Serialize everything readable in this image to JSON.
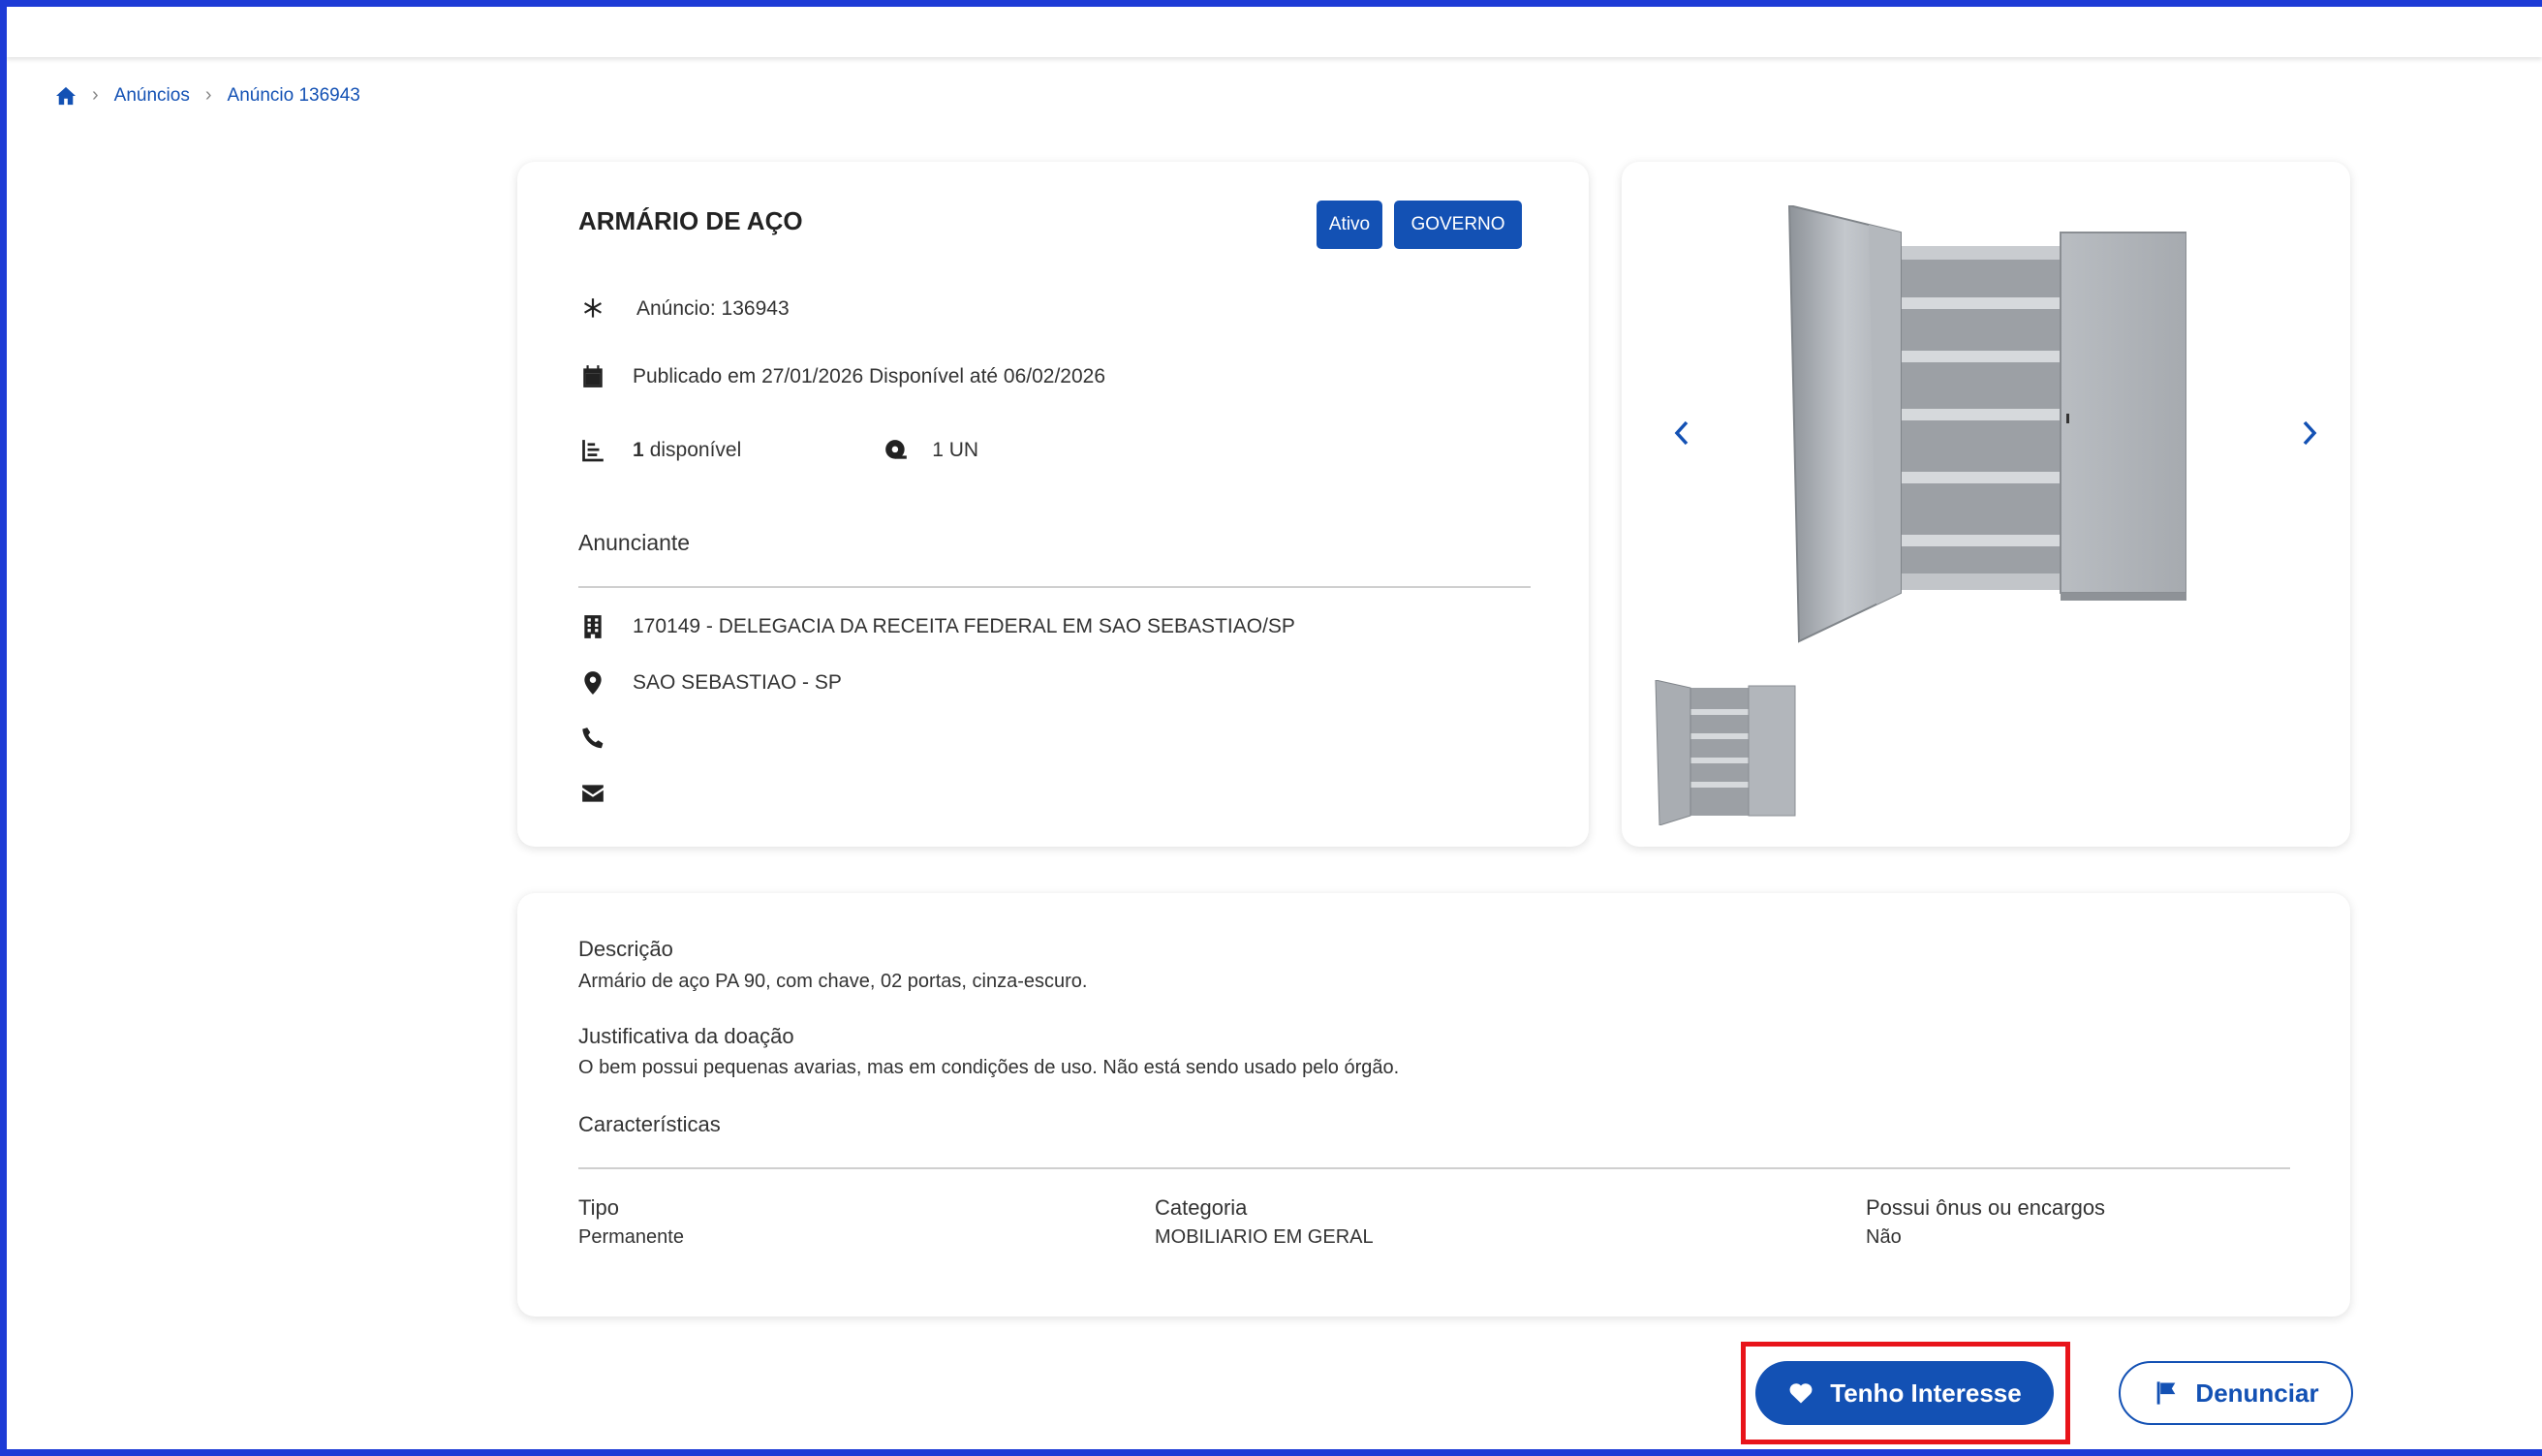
{
  "breadcrumb": {
    "items": [
      "Anúncios",
      "Anúncio 136943"
    ]
  },
  "listing": {
    "title": "ARMÁRIO DE AÇO",
    "badges": {
      "status": "Ativo",
      "type": "GOVERNO"
    },
    "ad_number": "Anúncio: 136943",
    "published": "Publicado em 27/01/2026 Disponível até 06/02/2026",
    "available_count": "1",
    "available_label": "disponível",
    "unit": "1 UN",
    "advertiser_heading": "Anunciante",
    "advertiser_org": "170149 - DELEGACIA DA RECEITA FEDERAL EM SAO SEBASTIAO/SP",
    "advertiser_location": "SAO SEBASTIAO - SP"
  },
  "details": {
    "description_label": "Descrição",
    "description_text": "Armário de aço PA 90, com chave, 02 portas, cinza-escuro.",
    "justification_label": "Justificativa da doação",
    "justification_text": "O bem possui pequenas avarias, mas em condições de uso. Não está sendo usado pelo órgão.",
    "characteristics_label": "Características",
    "fields": [
      {
        "label": "Tipo",
        "value": "Permanente"
      },
      {
        "label": "Categoria",
        "value": "MOBILIARIO EM GERAL"
      },
      {
        "label": "Possui ônus ou encargos",
        "value": "Não"
      }
    ]
  },
  "actions": {
    "interest_label": "Tenho Interesse",
    "report_label": "Denunciar"
  },
  "colors": {
    "primary": "#1351b4",
    "frame": "#1d3bd6",
    "highlight": "#e8141a"
  }
}
